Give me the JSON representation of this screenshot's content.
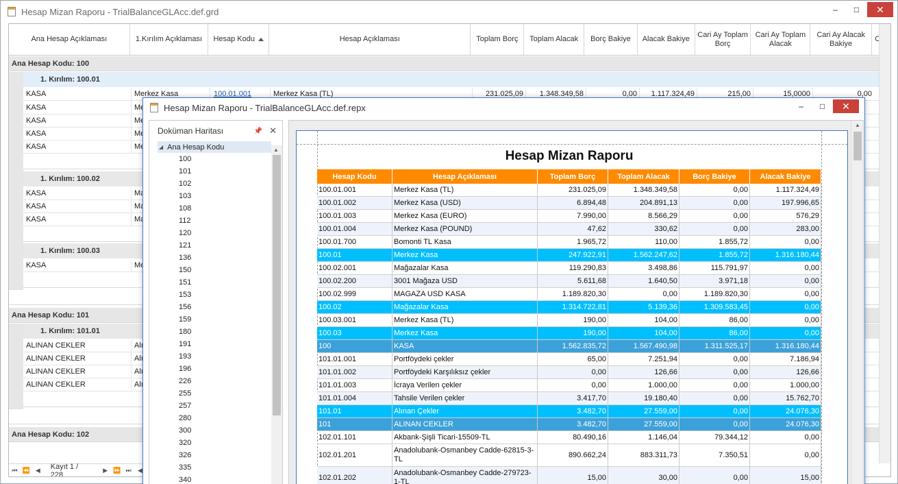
{
  "back_window": {
    "title": "Hesap Mizan Raporu - TrialBalanceGLAcc.def.grd",
    "controls": {
      "minimize": "–",
      "maximize": "□",
      "close": "✕"
    },
    "columns": [
      {
        "label": "Ana Hesap Açıklaması"
      },
      {
        "label": "1.Kırılım Açıklaması"
      },
      {
        "label": "Hesap Kodu"
      },
      {
        "label": "Hesap Açıklaması"
      },
      {
        "label": "Toplam Borç"
      },
      {
        "label": "Toplam Alacak"
      },
      {
        "label": "Borç Bakiye"
      },
      {
        "label": "Alacak Bakiye"
      },
      {
        "label": "Cari Ay Toplam Borç"
      },
      {
        "label": "Cari Ay Toplam Alacak"
      },
      {
        "label": "Cari Ay Alacak Bakiye"
      },
      {
        "label": "Cari B"
      }
    ],
    "groups": {
      "g100": "Ana Hesap Kodu: 100",
      "s10001": "1. Kırılım: 100.01",
      "s10002": "1. Kırılım: 100.02",
      "s10003": "1. Kırılım: 100.03",
      "g101": "Ana Hesap Kodu: 101",
      "s10101": "1. Kırılım: 101.01",
      "g102": "Ana Hesap Kodu: 102"
    },
    "first_row": {
      "ana": "KASA",
      "kirilim": "Merkez Kasa",
      "kod": "100.01.001",
      "aciklama": "Merkez Kasa (TL)",
      "borc": "231.025,09",
      "alacak": "1.348.349,58",
      "borc_bakiye": "0,00",
      "alacak_bakiye": "1.117.324,49",
      "cari_borc": "215,00",
      "cari_alacak": "15,0000",
      "cari_alacak_bakiye": "0,00"
    },
    "kasa_label": "KASA",
    "me_label": "Me",
    "ma_label": "Ma",
    "cek_label": "ALINAN CEKLER",
    "al_label": "Alı",
    "nav": {
      "record_text": "Kayıt 1 / 228"
    }
  },
  "front_window": {
    "title": "Hesap Mizan Raporu - TrialBalanceGLAcc.def.repx",
    "controls": {
      "minimize": "–",
      "maximize": "□",
      "close": "✕"
    },
    "doc_map": {
      "title": "Doküman Haritası",
      "root": "Ana Hesap Kodu",
      "items": [
        "100",
        "101",
        "102",
        "103",
        "108",
        "112",
        "120",
        "121",
        "136",
        "150",
        "151",
        "153",
        "156",
        "159",
        "180",
        "191",
        "193",
        "196",
        "226",
        "255",
        "257",
        "280",
        "300",
        "320",
        "326",
        "335",
        "340"
      ]
    },
    "report": {
      "title": "Hesap Mizan Raporu",
      "headers": [
        "Hesap Kodu",
        "Hesap Açıklaması",
        "Toplam Borç",
        "Toplam Alacak",
        "Borç Bakiye",
        "Alacak Bakiye"
      ],
      "rows": [
        {
          "type": "n",
          "cells": [
            "100.01.001",
            "Merkez Kasa (TL)",
            "231.025,09",
            "1.348.349,58",
            "0,00",
            "1.117.324,49"
          ]
        },
        {
          "type": "a",
          "cells": [
            "100.01.002",
            "Merkez Kasa (USD)",
            "6.894,48",
            "204.891,13",
            "0,00",
            "197.996,65"
          ]
        },
        {
          "type": "n",
          "cells": [
            "100.01.003",
            "Merkez Kasa (EURO)",
            "7.990,00",
            "8.566,29",
            "0,00",
            "576,29"
          ]
        },
        {
          "type": "a",
          "cells": [
            "100.01.004",
            "Merkez Kasa (POUND)",
            "47,62",
            "330,62",
            "0,00",
            "283,00"
          ]
        },
        {
          "type": "n",
          "cells": [
            "100.01.700",
            "Bomonti TL Kasa",
            "1.965,72",
            "110,00",
            "1.855,72",
            "0,00"
          ]
        },
        {
          "type": "s",
          "cells": [
            "100.01",
            "Merkez Kasa",
            "247.922,91",
            "1.562.247,62",
            "1.855,72",
            "1.316.180,44"
          ]
        },
        {
          "type": "n",
          "cells": [
            "100.02.001",
            "Mağazalar Kasa",
            "119.290,83",
            "3.498,86",
            "115.791,97",
            "0,00"
          ]
        },
        {
          "type": "a",
          "cells": [
            "100.02.200",
            "3001 Mağaza USD",
            "5.611,68",
            "1.640,50",
            "3.971,18",
            "0,00"
          ]
        },
        {
          "type": "n",
          "cells": [
            "100.02.999",
            "MAGAZA USD KASA",
            "1.189.820,30",
            "0,00",
            "1.189.820,30",
            "0,00"
          ]
        },
        {
          "type": "s",
          "cells": [
            "100.02",
            "Mağazalar Kasa",
            "1.314.722,81",
            "5.139,36",
            "1.309.583,45",
            "0,00"
          ]
        },
        {
          "type": "n",
          "cells": [
            "100.03.001",
            "Merkez Kasa (TL)",
            "190,00",
            "104,00",
            "86,00",
            "0,00"
          ]
        },
        {
          "type": "s",
          "cells": [
            "100.03",
            "Merkez Kasa",
            "190,00",
            "104,00",
            "86,00",
            "0,00"
          ]
        },
        {
          "type": "t",
          "cells": [
            "100",
            "KASA",
            "1.562.835,72",
            "1.567.490,98",
            "1.311.525,17",
            "1.316.180,44"
          ]
        },
        {
          "type": "n",
          "cells": [
            "101.01.001",
            "Portföydeki çekler",
            "65,00",
            "7.251,94",
            "0,00",
            "7.186,94"
          ]
        },
        {
          "type": "a",
          "cells": [
            "101.01.002",
            "Portföydeki Karşılıksız çekler",
            "0,00",
            "126,66",
            "0,00",
            "126,66"
          ]
        },
        {
          "type": "n",
          "cells": [
            "101.01.003",
            "İcraya Verilen çekler",
            "0,00",
            "1.000,00",
            "0,00",
            "1.000,00"
          ]
        },
        {
          "type": "a",
          "cells": [
            "101.01.004",
            "Tahsile Verilen çekler",
            "3.417,70",
            "19.180,40",
            "0,00",
            "15.762,70"
          ]
        },
        {
          "type": "s",
          "cells": [
            "101.01",
            "Alınan Çekler",
            "3.482,70",
            "27.559,00",
            "0,00",
            "24.076,30"
          ]
        },
        {
          "type": "t",
          "cells": [
            "101",
            "ALINAN CEKLER",
            "3.482,70",
            "27.559,00",
            "0,00",
            "24.076,30"
          ]
        },
        {
          "type": "n",
          "cells": [
            "102.01.101",
            "Akbank-Şişli Ticari-15509-TL",
            "80.490,16",
            "1.146,04",
            "79.344,12",
            "0,00"
          ]
        },
        {
          "type": "nt",
          "cells": [
            "102.01.201",
            "Anadolubank-Osmanbey Cadde-62815-3-TL",
            "890.662,24",
            "883.311,73",
            "7.350,51",
            "0,00"
          ]
        },
        {
          "type": "at",
          "cells": [
            "102.01.202",
            "Anadolubank-Osmanbey Cadde-279723-1-TL",
            "15,00",
            "30,00",
            "0,00",
            "15,00"
          ]
        }
      ]
    }
  }
}
